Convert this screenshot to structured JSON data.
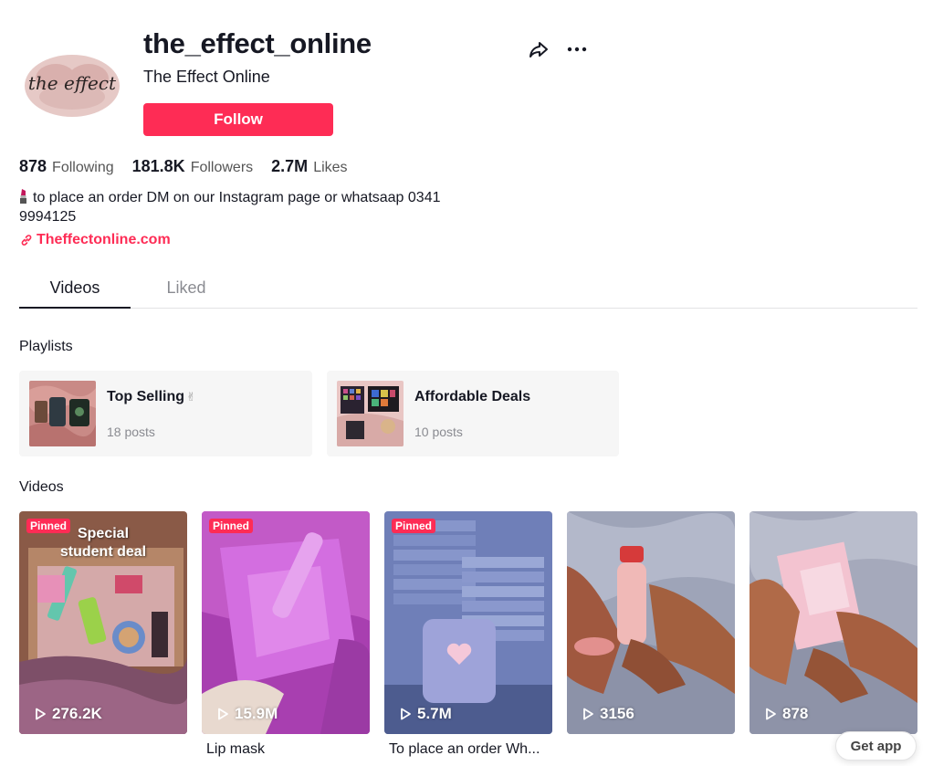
{
  "profile": {
    "username": "the_effect_online",
    "nickname": "The Effect Online",
    "avatar_text": "the effect",
    "follow_label": "Follow"
  },
  "stats": {
    "following_count": "878",
    "following_label": "Following",
    "followers_count": "181.8K",
    "followers_label": "Followers",
    "likes_count": "2.7M",
    "likes_label": "Likes"
  },
  "bio": {
    "emoji": "lipstick",
    "line1": "to place an order DM on our Instagram page or whatsaap 0341",
    "line2": "9994125",
    "link": "Theffectonline.com"
  },
  "tabs": [
    {
      "label": "Videos",
      "active": true
    },
    {
      "label": "Liked",
      "active": false
    }
  ],
  "playlists_title": "Playlists",
  "playlists": [
    {
      "name": "Top Selling",
      "emoji": "✌",
      "posts": "18 posts"
    },
    {
      "name": "Affordable Deals",
      "posts": "10 posts"
    }
  ],
  "videos_title": "Videos",
  "videos": [
    {
      "pinned_label": "Pinned",
      "overlay": "Special student deal",
      "overlay_line1": "Special",
      "overlay_line2": "student deal",
      "views": "276.2K",
      "caption": ""
    },
    {
      "pinned_label": "Pinned",
      "views": "15.9M",
      "caption": "Lip mask"
    },
    {
      "pinned_label": "Pinned",
      "views": "5.7M",
      "caption": "To place an order Wh..."
    },
    {
      "views": "3156",
      "caption": ""
    },
    {
      "views": "878",
      "caption": ""
    }
  ],
  "get_app_label": "Get app",
  "colors": {
    "accent": "#fe2c55",
    "text": "#161823",
    "muted": "#8a8b91"
  },
  "icons": [
    "share-icon",
    "more-icon",
    "link-icon",
    "play-icon",
    "lipstick-icon"
  ]
}
